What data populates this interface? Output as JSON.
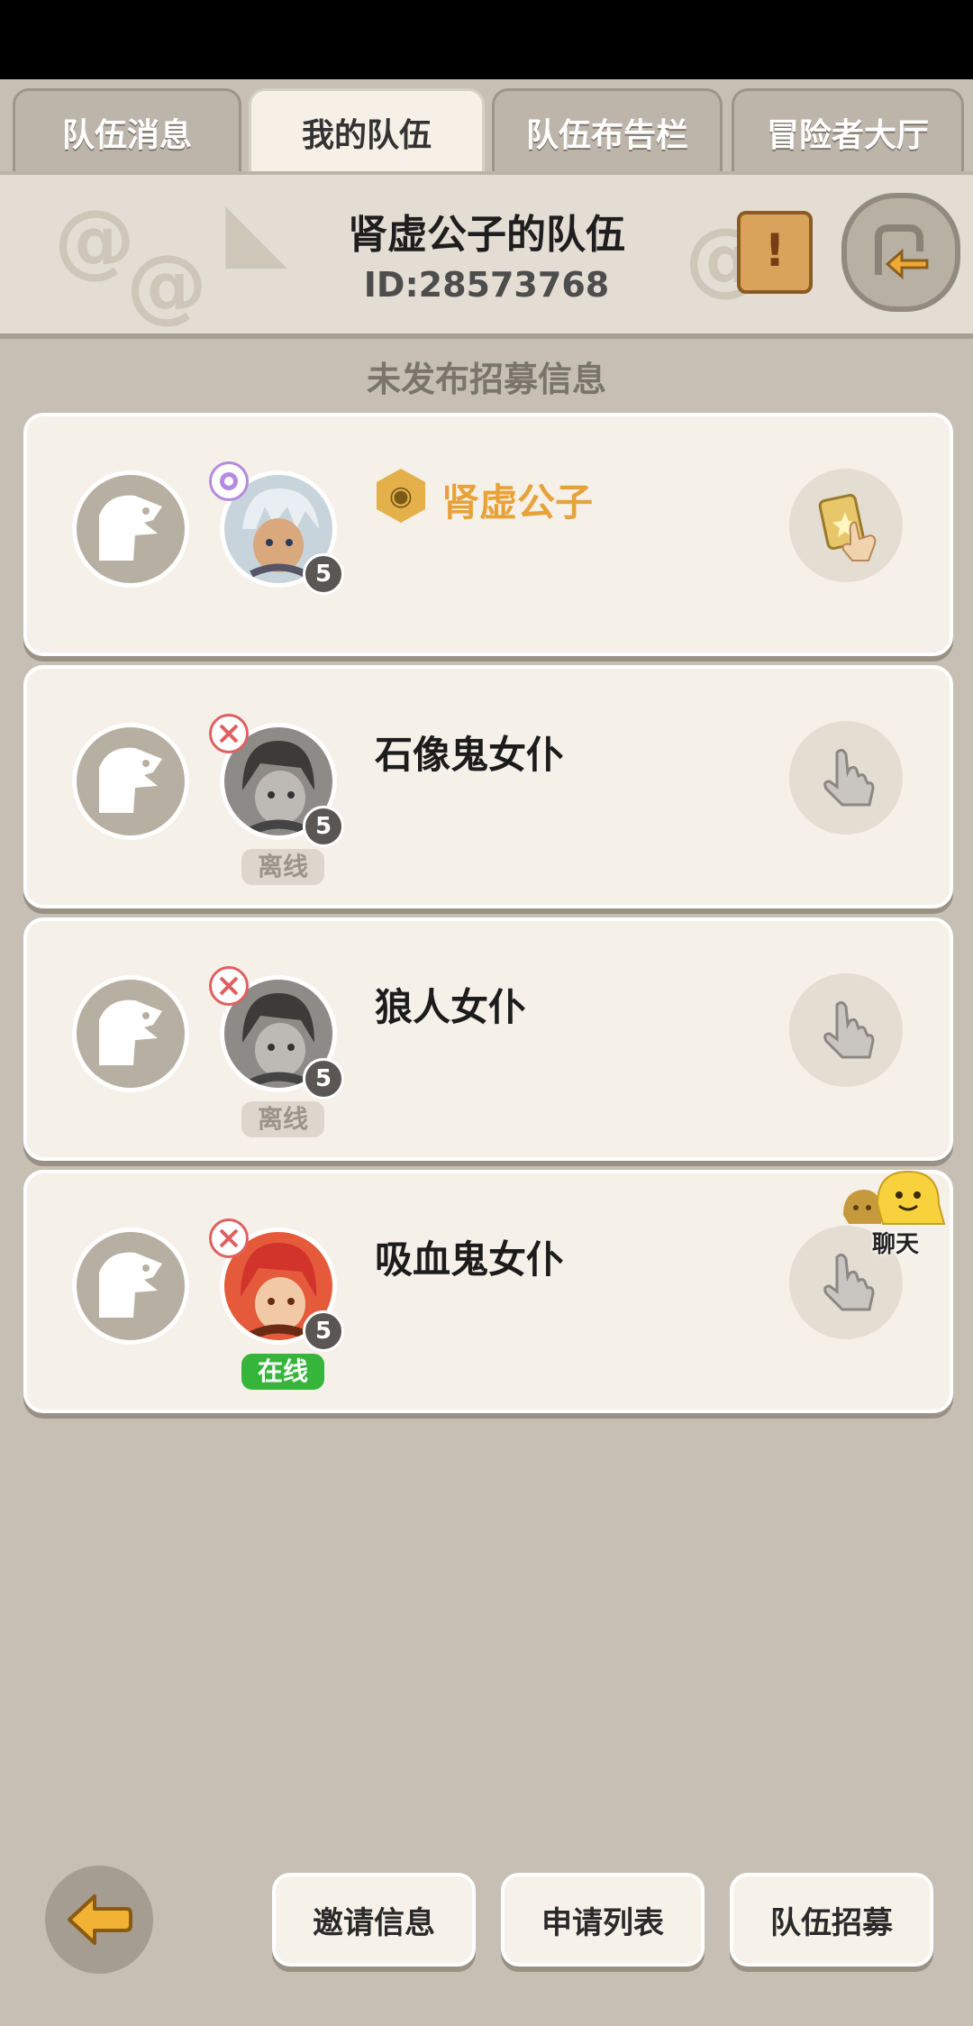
{
  "tabs": [
    {
      "label": "队伍消息"
    },
    {
      "label": "我的队伍"
    },
    {
      "label": "队伍布告栏"
    },
    {
      "label": "冒险者大厅"
    }
  ],
  "header": {
    "title": "肾虚公子的队伍",
    "team_id": "ID:28573768"
  },
  "recruit_status": "未发布招募信息",
  "members": [
    {
      "name": "肾虚公子",
      "level": "5",
      "role": "leader",
      "status": ""
    },
    {
      "name": "石像鬼女仆",
      "level": "5",
      "role": "member",
      "status": "离线"
    },
    {
      "name": "狼人女仆",
      "level": "5",
      "role": "member",
      "status": "离线"
    },
    {
      "name": "吸血鬼女仆",
      "level": "5",
      "role": "member",
      "status": "在线"
    }
  ],
  "chat": {
    "label": "聊天"
  },
  "bottom": {
    "invite": "邀请信息",
    "apply_list": "申请列表",
    "recruit": "队伍招募"
  },
  "colors": {
    "background": "#c7bfb3",
    "leader_name": "#e7a33a",
    "online": "#35b53a"
  }
}
